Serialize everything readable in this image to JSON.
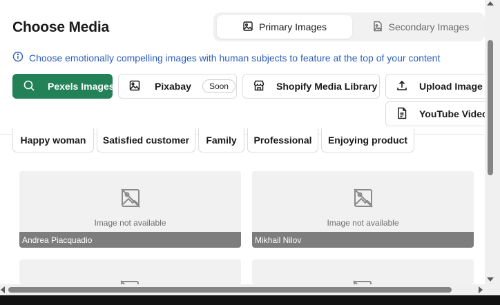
{
  "header": {
    "title": "Choose Media"
  },
  "tabs": [
    {
      "label": "Primary Images",
      "icon": "image-icon",
      "active": true
    },
    {
      "label": "Secondary Images",
      "icon": "image-file-icon",
      "active": false
    }
  ],
  "info": {
    "icon": "info-icon",
    "text": "Choose emotionally compelling images with human subjects to feature at the top of your content"
  },
  "sources": [
    {
      "label": "Pexels Images",
      "icon": "search-icon",
      "active": true
    },
    {
      "label": "Pixabay",
      "icon": "image-icon",
      "badge": "Soon"
    },
    {
      "label": "Shopify Media Library",
      "icon": "store-icon"
    },
    {
      "label": "Upload Image",
      "icon": "upload-icon"
    },
    {
      "label": "YouTube Video",
      "icon": "document-icon"
    }
  ],
  "suggestions": [
    "Happy woman",
    "Satisfied customer",
    "Family",
    "Professional",
    "Enjoying product"
  ],
  "results": [
    {
      "placeholder": "Image not available",
      "credit": "Andrea Piacquadio"
    },
    {
      "placeholder": "Image not available",
      "credit": "Mikhail Nilov"
    },
    {
      "placeholder": "",
      "credit": ""
    },
    {
      "placeholder": "",
      "credit": ""
    }
  ],
  "colors": {
    "accent": "#238157",
    "info_text": "#2b5dbb",
    "caption_bg": "#7d7d7d"
  }
}
